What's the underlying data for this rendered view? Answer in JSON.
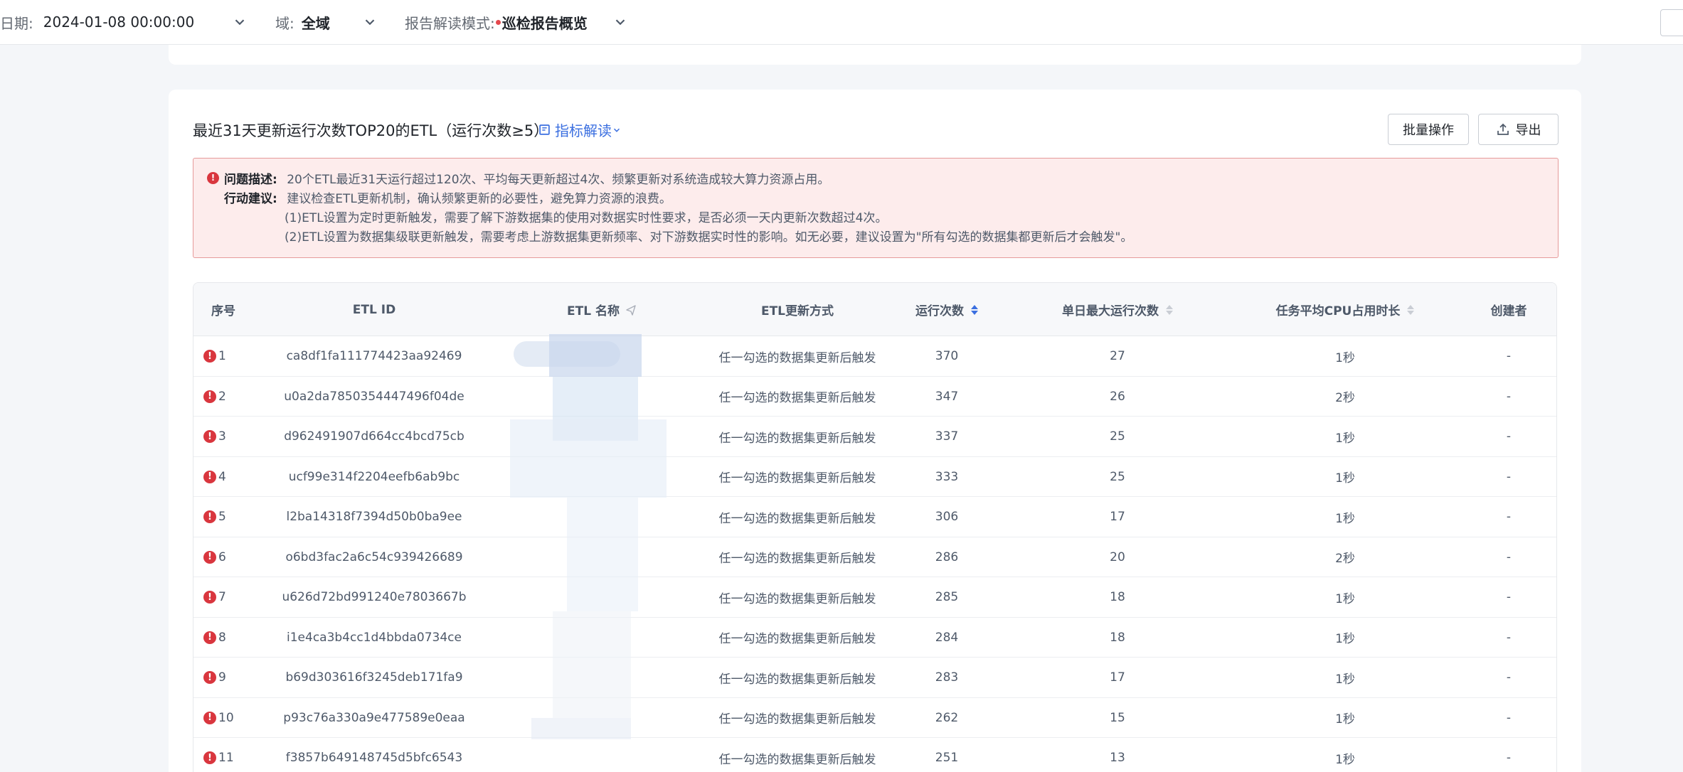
{
  "filters": {
    "date_label": "日期:",
    "date_value": "2024-01-08 00:00:00",
    "domain_label": "域:",
    "domain_value": "全域",
    "mode_label": "报告解读模式:",
    "mode_value": "巡检报告概览"
  },
  "section": {
    "title": "最近31天更新运行次数TOP20的ETL（运行次数≥5）",
    "interpret_link": "指标解读",
    "batch_button": "批量操作",
    "export_button": "导出"
  },
  "alert": {
    "problem_label": "问题描述:",
    "problem_text": "20个ETL最近31天运行超过120次、平均每天更新超过4次、频繁更新对系统造成较大算力资源占用。",
    "action_label": "行动建议:",
    "action_text": "建议检查ETL更新机制，确认频繁更新的必要性，避免算力资源的浪费。",
    "item1": "(1)ETL设置为定时更新触发，需要了解下游数据集的使用对数据实时性要求，是否必须一天内更新次数超过4次。",
    "item2": "(2)ETL设置为数据集级联更新触发，需要考虑上游数据集更新频率、对下游数据实时性的影响。如无必要，建议设置为\"所有勾选的数据集都更新后才会触发\"。"
  },
  "table": {
    "headers": {
      "index": "序号",
      "etl_id": "ETL ID",
      "etl_name": "ETL 名称",
      "update_mode": "ETL更新方式",
      "run_count": "运行次数",
      "daily_max": "单日最大运行次数",
      "cpu_avg": "任务平均CPU占用时长",
      "creator": "创建者"
    },
    "rows": [
      {
        "index": "1",
        "etl_id": "ca8df1fa111774423aa92469",
        "update_mode": "任一勾选的数据集更新后触发",
        "run_count": "370",
        "daily_max": "27",
        "cpu_avg": "1秒",
        "creator": "-"
      },
      {
        "index": "2",
        "etl_id": "u0a2da7850354447496f04de",
        "update_mode": "任一勾选的数据集更新后触发",
        "run_count": "347",
        "daily_max": "26",
        "cpu_avg": "2秒",
        "creator": "-"
      },
      {
        "index": "3",
        "etl_id": "d962491907d664cc4bcd75cb",
        "update_mode": "任一勾选的数据集更新后触发",
        "run_count": "337",
        "daily_max": "25",
        "cpu_avg": "1秒",
        "creator": "-"
      },
      {
        "index": "4",
        "etl_id": "ucf99e314f2204eefb6ab9bc",
        "update_mode": "任一勾选的数据集更新后触发",
        "run_count": "333",
        "daily_max": "25",
        "cpu_avg": "1秒",
        "creator": "-"
      },
      {
        "index": "5",
        "etl_id": "l2ba14318f7394d50b0ba9ee",
        "update_mode": "任一勾选的数据集更新后触发",
        "run_count": "306",
        "daily_max": "17",
        "cpu_avg": "1秒",
        "creator": "-"
      },
      {
        "index": "6",
        "etl_id": "o6bd3fac2a6c54c939426689",
        "update_mode": "任一勾选的数据集更新后触发",
        "run_count": "286",
        "daily_max": "20",
        "cpu_avg": "2秒",
        "creator": "-"
      },
      {
        "index": "7",
        "etl_id": "u626d72bd991240e7803667b",
        "update_mode": "任一勾选的数据集更新后触发",
        "run_count": "285",
        "daily_max": "18",
        "cpu_avg": "1秒",
        "creator": "-"
      },
      {
        "index": "8",
        "etl_id": "i1e4ca3b4cc1d4bbda0734ce",
        "update_mode": "任一勾选的数据集更新后触发",
        "run_count": "284",
        "daily_max": "18",
        "cpu_avg": "1秒",
        "creator": "-"
      },
      {
        "index": "9",
        "etl_id": "b69d303616f3245deb171fa9",
        "update_mode": "任一勾选的数据集更新后触发",
        "run_count": "283",
        "daily_max": "17",
        "cpu_avg": "1秒",
        "creator": "-"
      },
      {
        "index": "10",
        "etl_id": "p93c76a330a9e477589e0eaa",
        "update_mode": "任一勾选的数据集更新后触发",
        "run_count": "262",
        "daily_max": "15",
        "cpu_avg": "1秒",
        "creator": "-"
      },
      {
        "index": "11",
        "etl_id": "f3857b649148745d5bfc6543",
        "update_mode": "任一勾选的数据集更新后触发",
        "run_count": "251",
        "daily_max": "13",
        "cpu_avg": "1秒",
        "creator": "-"
      }
    ]
  },
  "colors": {
    "accent": "#3b6fe0",
    "error": "#d9363e",
    "alert_bg": "#fdecec",
    "alert_border": "#e69a9a"
  }
}
